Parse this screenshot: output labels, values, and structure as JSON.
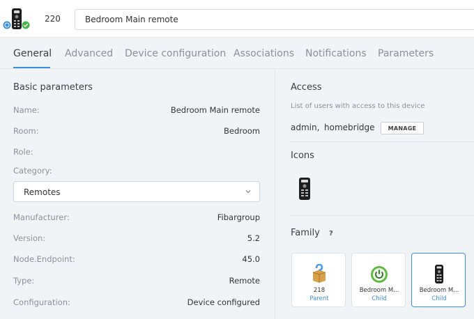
{
  "header": {
    "device_id": "220",
    "device_name": "Bedroom Main remote",
    "icon": "remote-control-icon",
    "badges": [
      "info-badge-icon",
      "check-badge-icon"
    ]
  },
  "tabs": [
    "General",
    "Advanced",
    "Device configuration",
    "Associations",
    "Notifications",
    "Parameters"
  ],
  "active_tab": "General",
  "basic": {
    "title": "Basic parameters",
    "name_label": "Name:",
    "name_value": "Bedroom Main remote",
    "room_label": "Room:",
    "room_value": "Bedroom",
    "role_label": "Role:",
    "category_label": "Category:",
    "category_value": "Remotes",
    "manufacturer_label": "Manufacturer:",
    "manufacturer_value": "Fibargroup",
    "version_label": "Version:",
    "version_value": "5.2",
    "endpoint_label": "Node.Endpoint:",
    "endpoint_value": "45.0",
    "type_label": "Type:",
    "type_value": "Remote",
    "configuration_label": "Configuration:",
    "configuration_value": "Device configured"
  },
  "access": {
    "title": "Access",
    "subtitle": "List of users with access to this device",
    "users": [
      "admin,",
      "homebridge"
    ],
    "manage_label": "MANAGE"
  },
  "icons": {
    "title": "Icons",
    "current": "remote-control-icon"
  },
  "family": {
    "title": "Family",
    "help": "?",
    "members": [
      {
        "name": "218",
        "role": "Parent",
        "icon": "package-icon"
      },
      {
        "name": "Bedroom M...",
        "role": "Child",
        "icon": "power-icon"
      },
      {
        "name": "Bedroom M...",
        "role": "Child",
        "icon": "remote-control-icon"
      }
    ]
  },
  "colors": {
    "accent": "#3c8fe0",
    "success": "#45b549",
    "background": "#f1f4f7",
    "muted_text": "#8a9199"
  }
}
